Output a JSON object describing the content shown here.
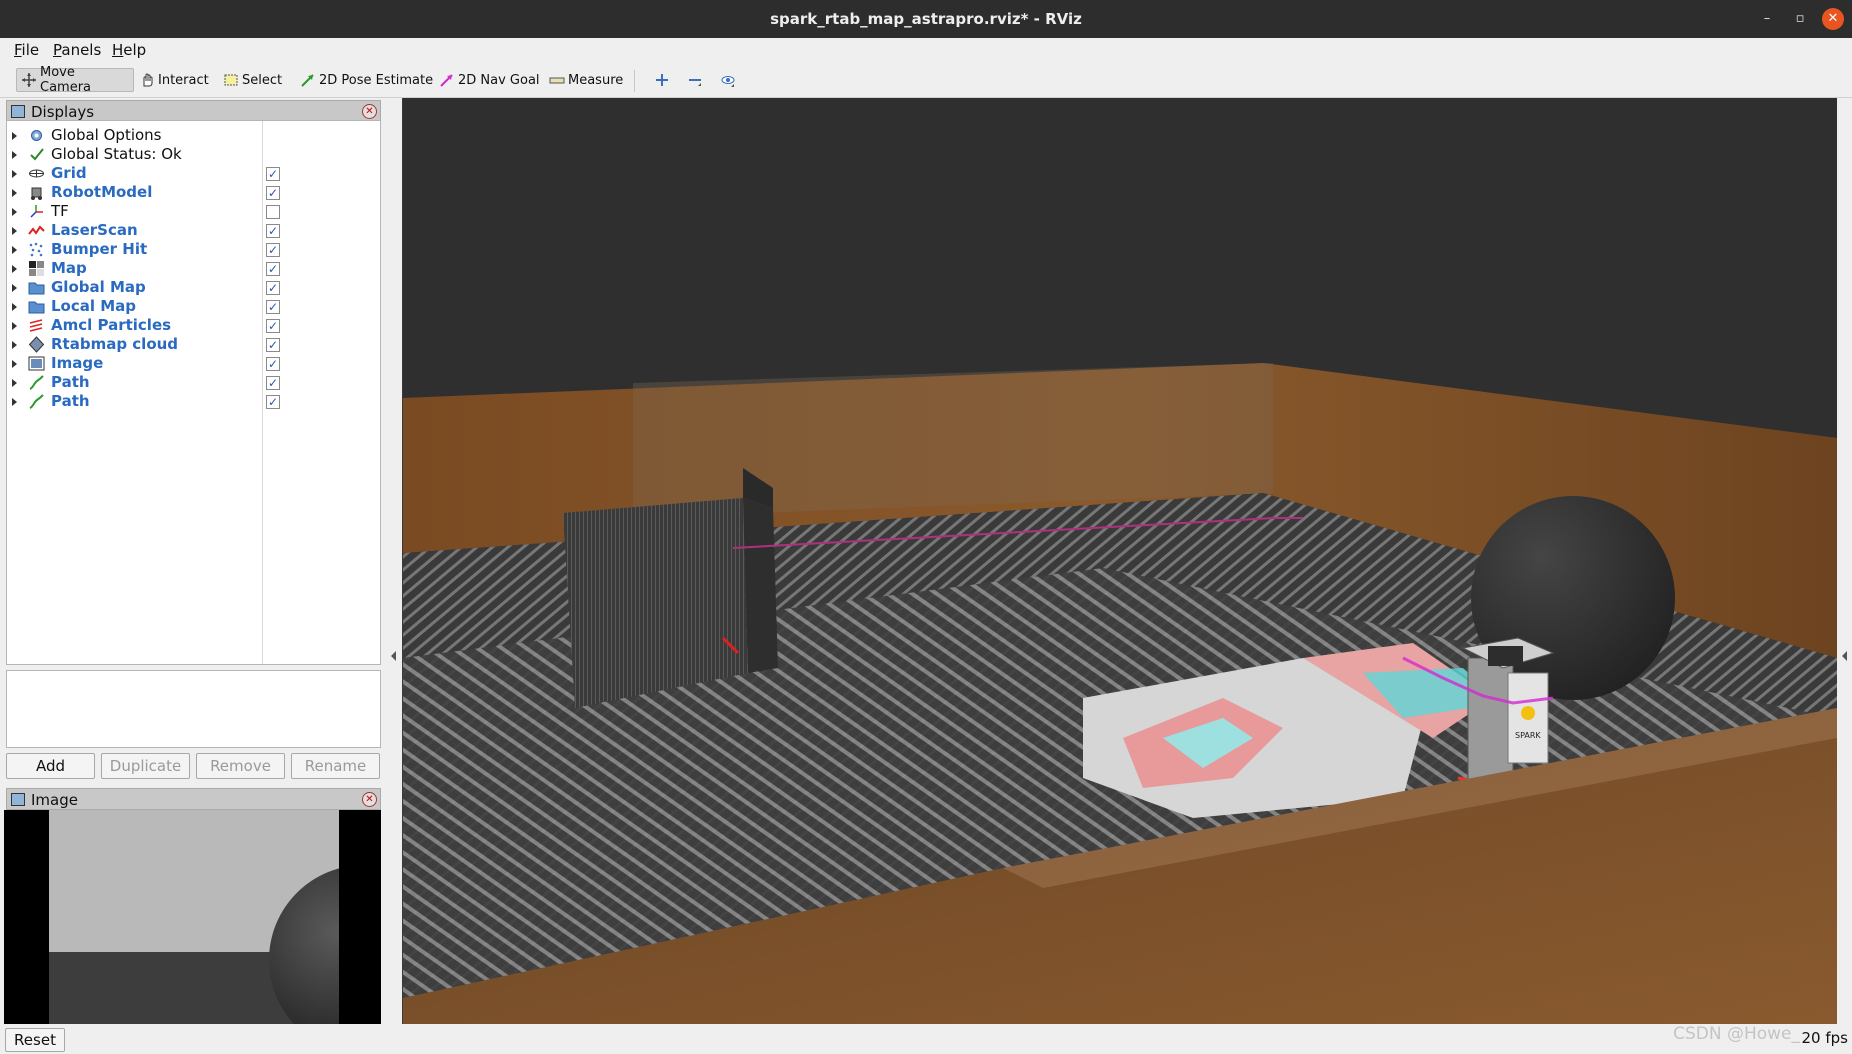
{
  "window": {
    "title": "spark_rtab_map_astrapro.rviz* - RViz",
    "controls": {
      "minimize": "–",
      "maximize": "▫",
      "close": "✕"
    }
  },
  "menu": [
    "File",
    "Panels",
    "Help"
  ],
  "toolbar": {
    "tools": [
      {
        "label": "Move Camera",
        "icon": "move-camera-icon",
        "active": true
      },
      {
        "label": "Interact",
        "icon": "hand-icon"
      },
      {
        "label": "Select",
        "icon": "select-box-icon"
      },
      {
        "label": "2D Pose Estimate",
        "icon": "green-arrow-icon"
      },
      {
        "label": "2D Nav Goal",
        "icon": "pink-arrow-icon"
      },
      {
        "label": "Measure",
        "icon": "ruler-icon"
      }
    ],
    "extra_icons": [
      "plus-icon",
      "minus-icon",
      "eye-icon"
    ]
  },
  "displays_panel": {
    "title": "Displays",
    "items": [
      {
        "label": "Global Options",
        "icon": "gear-icon",
        "checked": null,
        "blue": false
      },
      {
        "label": "Global Status: Ok",
        "icon": "checkmark-icon",
        "checked": null,
        "blue": false
      },
      {
        "label": "Grid",
        "icon": "grid-icon",
        "checked": true,
        "blue": true
      },
      {
        "label": "RobotModel",
        "icon": "robot-icon",
        "checked": true,
        "blue": true
      },
      {
        "label": "TF",
        "icon": "tf-axes-icon",
        "checked": false,
        "blue": false
      },
      {
        "label": "LaserScan",
        "icon": "laser-icon",
        "checked": true,
        "blue": true
      },
      {
        "label": "Bumper Hit",
        "icon": "points-icon",
        "checked": true,
        "blue": true
      },
      {
        "label": "Map",
        "icon": "map-icon",
        "checked": true,
        "blue": true
      },
      {
        "label": "Global Map",
        "icon": "folder-icon",
        "checked": true,
        "blue": true
      },
      {
        "label": "Local Map",
        "icon": "folder-icon",
        "checked": true,
        "blue": true
      },
      {
        "label": "Amcl Particles",
        "icon": "particles-icon",
        "checked": true,
        "blue": true
      },
      {
        "label": "Rtabmap cloud",
        "icon": "cloud-icon",
        "checked": true,
        "blue": true
      },
      {
        "label": "Image",
        "icon": "image-icon",
        "checked": true,
        "blue": true
      },
      {
        "label": "Path",
        "icon": "path-icon",
        "checked": true,
        "blue": true
      },
      {
        "label": "Path",
        "icon": "path-icon",
        "checked": true,
        "blue": true
      }
    ],
    "buttons": {
      "add": "Add",
      "duplicate": "Duplicate",
      "remove": "Remove",
      "rename": "Rename"
    }
  },
  "image_panel": {
    "title": "Image"
  },
  "footer": {
    "reset": "Reset",
    "fps": "20 fps",
    "watermark": "CSDN @Howe_"
  },
  "colors": {
    "accent_blue": "#2a6ac0",
    "close_orange": "#e95420",
    "floor": "#3c3c3c",
    "wood": "#8a4f22"
  }
}
